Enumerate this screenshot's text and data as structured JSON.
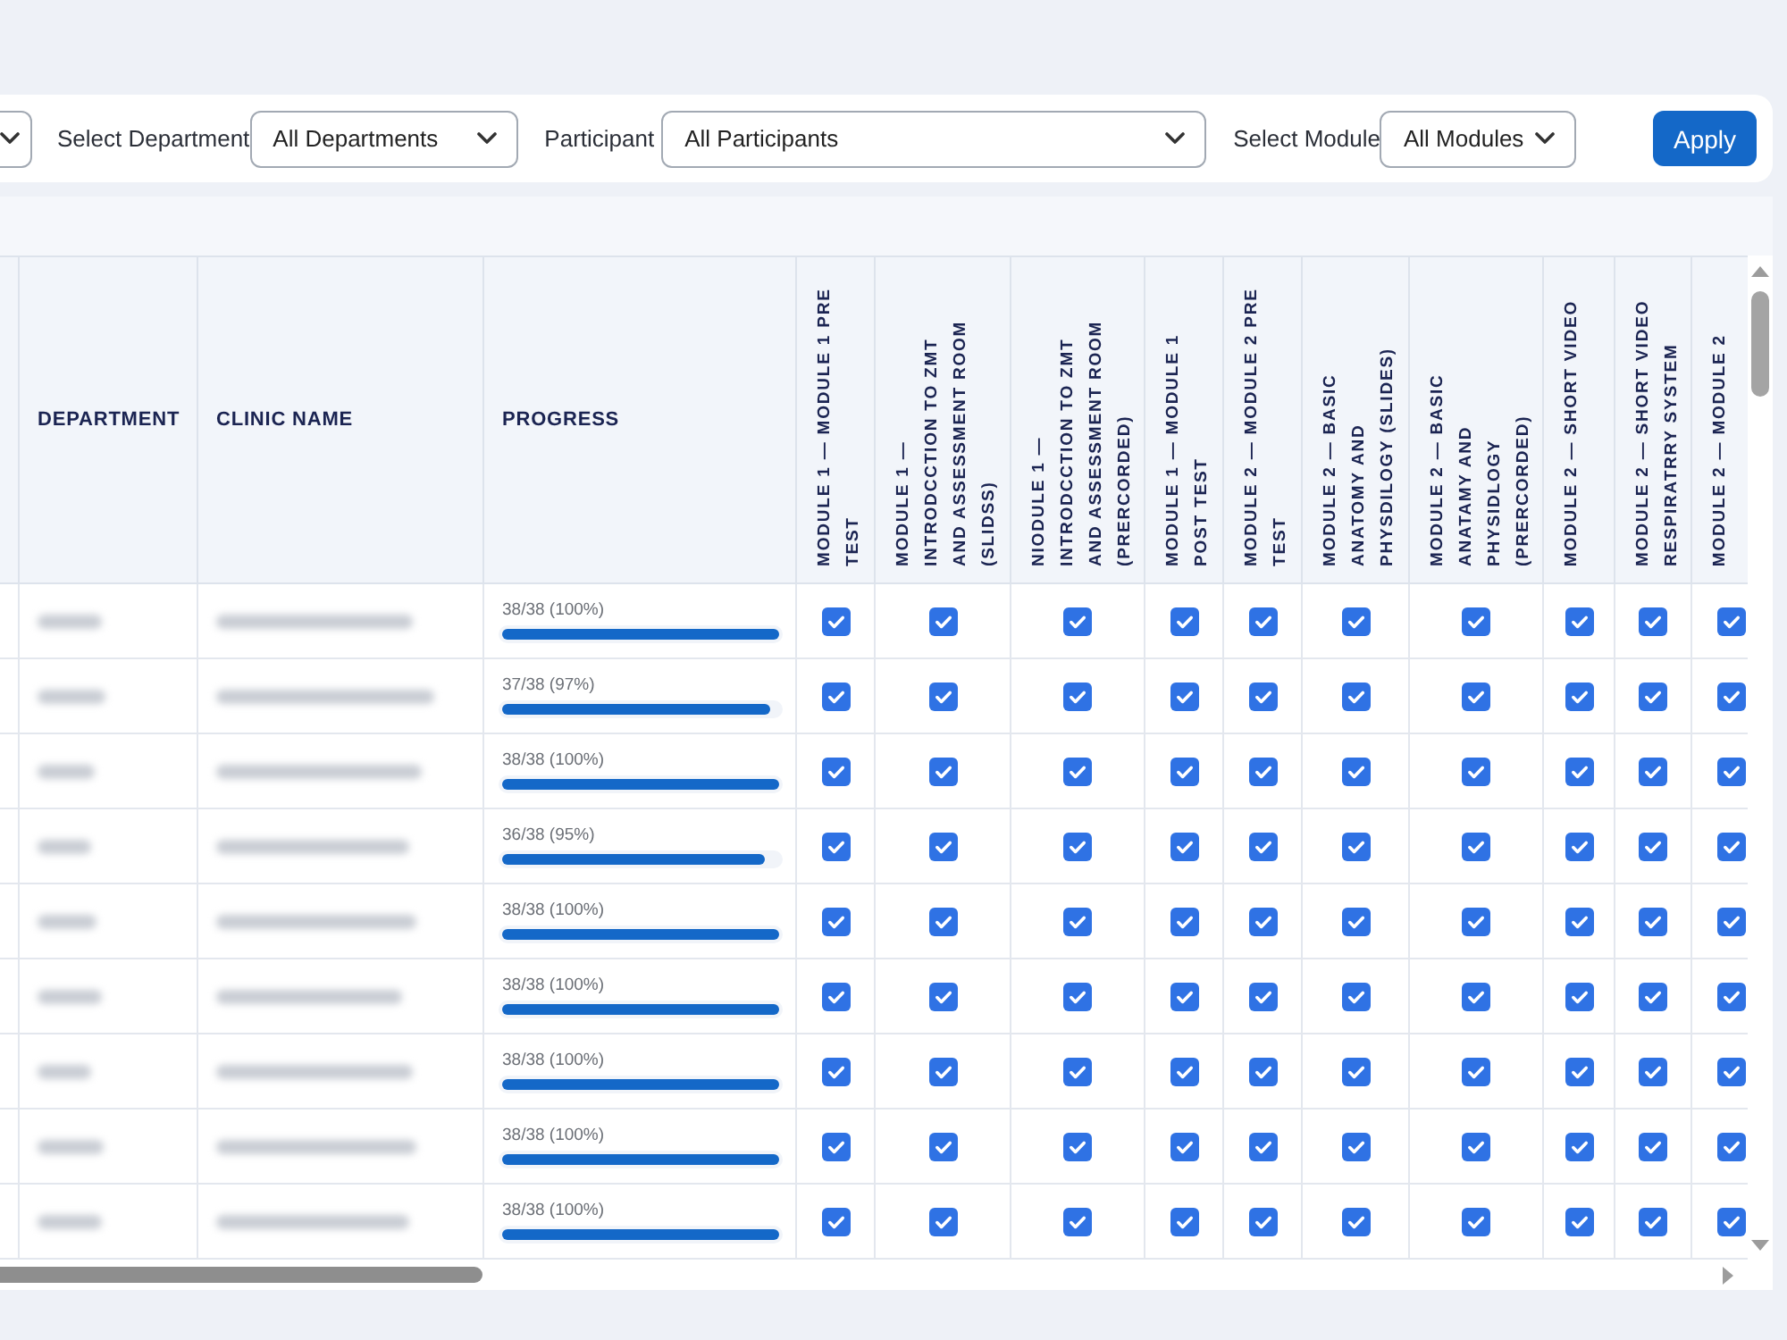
{
  "filters": [
    {
      "label": "Select Department",
      "value": "All Departments"
    },
    {
      "label": "Participant",
      "value": "All Participants"
    },
    {
      "label": "Select Module",
      "value": "All Modules"
    }
  ],
  "apply_button": "Apply",
  "table": {
    "columns": [
      "DEPARTMENT",
      "CLINIC NAME",
      "PROGRESS"
    ],
    "module_columns": [
      "MODULE 1 — MODULE 1 PRE TEST",
      "MODULE 1 — INTRODCCTION TO ZMT AND ASSESSMENT ROOM (SLIDSS)",
      "NIODULE 1 — INTRODCCTION TO ZMT AND ASSESSMENT ROOM (PRERCORDED)",
      "MODULE 1 — MODULE 1 POST TEST",
      "MODULE 2 — MODULE 2 PRE TEST",
      "MODULE 2 — BASIC ANATOMY AND PHYSDILOGY (SLIDES)",
      "MODULE 2 — BASIC ANATAMY AND PHYSIDLOGY (PRERCORDED)",
      "MODULE 2 — SHORT VIDEO",
      "MODULE 2 — SHORT VIDEO RESPIRATRRY SYSTEM",
      "MODULE 2 — MODULE 2"
    ],
    "rows": [
      {
        "progress": "38/38 (100%)",
        "level": 1,
        "modules": [
          {
            "checked": true
          },
          {
            "checked": true
          },
          {
            "checked": true
          },
          {
            "checked": true
          },
          {
            "checked": true
          },
          {
            "checked": true
          },
          {
            "checked": true
          },
          {
            "checked": true
          },
          {
            "checked": true
          },
          {
            "checked": true
          }
        ]
      },
      {
        "progress": "37/38 (97%)",
        "level": 0.97,
        "modules": [
          {
            "checked": true
          },
          {
            "checked": true
          },
          {
            "checked": true
          },
          {
            "checked": true
          },
          {
            "checked": true
          },
          {
            "checked": true
          },
          {
            "checked": true
          },
          {
            "checked": true
          },
          {
            "checked": true
          },
          {
            "checked": true
          }
        ]
      },
      {
        "progress": "38/38 (100%)",
        "level": 1,
        "modules": [
          {
            "checked": true
          },
          {
            "checked": true
          },
          {
            "checked": true
          },
          {
            "checked": true
          },
          {
            "checked": true
          },
          {
            "checked": true
          },
          {
            "checked": true
          },
          {
            "checked": true
          },
          {
            "checked": true
          },
          {
            "checked": true
          }
        ]
      },
      {
        "progress": "36/38 (95%)",
        "level": 0.95,
        "modules": [
          {
            "checked": true
          },
          {
            "checked": true
          },
          {
            "checked": true
          },
          {
            "checked": true
          },
          {
            "checked": true
          },
          {
            "checked": true
          },
          {
            "checked": true
          },
          {
            "checked": true
          },
          {
            "checked": true
          },
          {
            "checked": true
          }
        ]
      },
      {
        "progress": "38/38 (100%)",
        "level": 1,
        "modules": [
          {
            "checked": true
          },
          {
            "checked": true
          },
          {
            "checked": true
          },
          {
            "checked": true
          },
          {
            "checked": true
          },
          {
            "checked": true
          },
          {
            "checked": true
          },
          {
            "checked": true
          },
          {
            "checked": true
          },
          {
            "checked": true
          }
        ]
      },
      {
        "progress": "38/38 (100%)",
        "level": 1,
        "modules": [
          {
            "checked": true
          },
          {
            "checked": true
          },
          {
            "checked": true
          },
          {
            "checked": true
          },
          {
            "checked": true
          },
          {
            "checked": true
          },
          {
            "checked": true
          },
          {
            "checked": true
          },
          {
            "checked": true
          },
          {
            "checked": true
          }
        ]
      },
      {
        "progress": "38/38 (100%)",
        "level": 1,
        "modules": [
          {
            "checked": true
          },
          {
            "checked": true
          },
          {
            "checked": true
          },
          {
            "checked": true
          },
          {
            "checked": true
          },
          {
            "checked": true
          },
          {
            "checked": true
          },
          {
            "checked": true
          },
          {
            "checked": true
          },
          {
            "checked": true
          }
        ]
      },
      {
        "progress": "38/38 (100%)",
        "level": 1,
        "modules": [
          {
            "checked": true
          },
          {
            "checked": true
          },
          {
            "checked": true
          },
          {
            "checked": true
          },
          {
            "checked": true
          },
          {
            "checked": true
          },
          {
            "checked": true
          },
          {
            "checked": true
          },
          {
            "checked": true
          },
          {
            "checked": true
          }
        ]
      },
      {
        "progress": "38/38 (100%)",
        "level": 1,
        "modules": [
          {
            "checked": true
          },
          {
            "checked": true
          },
          {
            "checked": true
          },
          {
            "checked": true
          },
          {
            "checked": true
          },
          {
            "checked": true
          },
          {
            "checked": true
          },
          {
            "checked": true
          },
          {
            "checked": true
          },
          {
            "checked": true
          }
        ]
      }
    ]
  }
}
